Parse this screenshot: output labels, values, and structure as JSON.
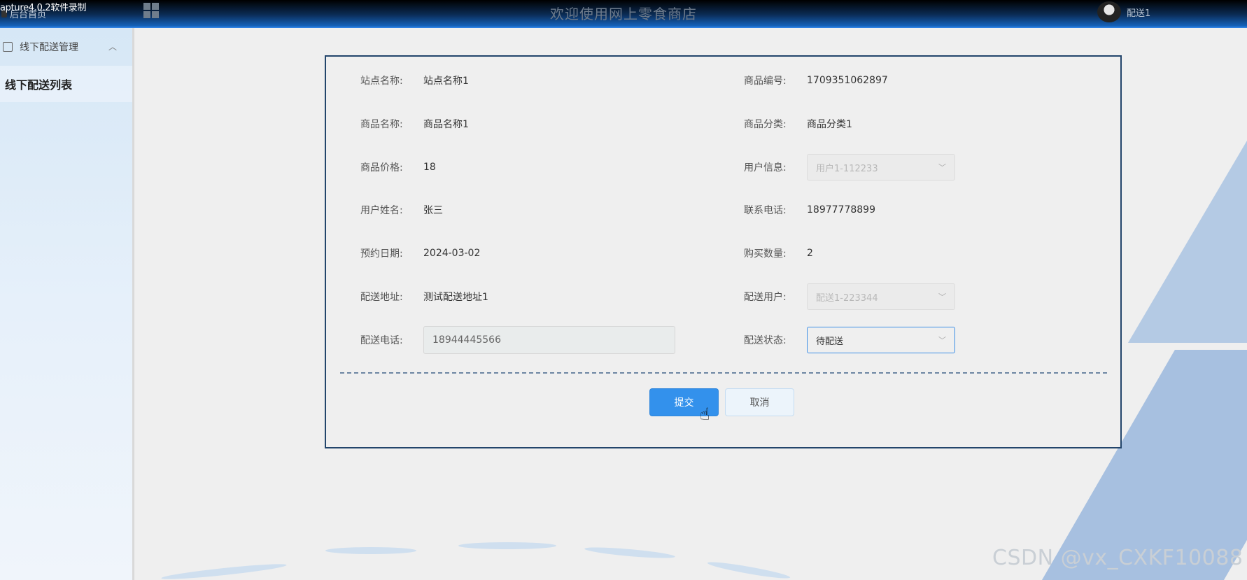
{
  "watermark_top": "apture4.0.2软件录制",
  "header": {
    "home_link": "后台首页",
    "site_title": "欢迎使用网上零食商店",
    "user_name": "配送1"
  },
  "sidebar": {
    "group_label": "线下配送管理",
    "items": [
      {
        "label": "线下配送列表"
      }
    ]
  },
  "form": {
    "station_name": {
      "label": "站点名称:",
      "value": "站点名称1"
    },
    "product_no": {
      "label": "商品编号:",
      "value": "1709351062897"
    },
    "product_name": {
      "label": "商品名称:",
      "value": "商品名称1"
    },
    "product_category": {
      "label": "商品分类:",
      "value": "商品分类1"
    },
    "product_price": {
      "label": "商品价格:",
      "value": "18"
    },
    "user_info": {
      "label": "用户信息:",
      "value": "用户1-112233"
    },
    "user_name": {
      "label": "用户姓名:",
      "value": "张三"
    },
    "contact_phone": {
      "label": "联系电话:",
      "value": "18977778899"
    },
    "reserve_date": {
      "label": "预约日期:",
      "value": "2024-03-02"
    },
    "quantity": {
      "label": "购买数量:",
      "value": "2"
    },
    "delivery_address": {
      "label": "配送地址:",
      "value": "测试配送地址1"
    },
    "delivery_user": {
      "label": "配送用户:",
      "value": "配送1-223344"
    },
    "delivery_phone": {
      "label": "配送电话:",
      "value": "18944445566"
    },
    "delivery_status": {
      "label": "配送状态:",
      "value": "待配送"
    },
    "submit_label": "提交",
    "cancel_label": "取消"
  },
  "footer_watermark": "CSDN @vx_CXKF10088",
  "colors": {
    "primary": "#3391ec",
    "header_dark": "#000000",
    "header_blue": "#1565c0"
  }
}
